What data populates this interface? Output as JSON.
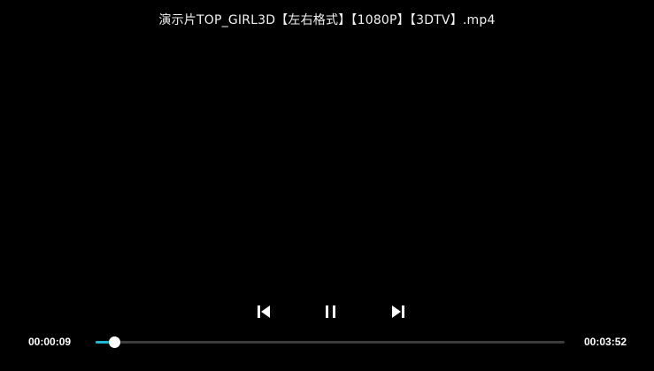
{
  "video": {
    "title": "演示片TOP_GIRL3D【左右格式】【1080P】【3DTV】.mp4"
  },
  "controls": {
    "previous_icon": "skip-previous-icon",
    "pause_icon": "pause-icon",
    "next_icon": "skip-next-icon"
  },
  "playback": {
    "current_time": "00:00:09",
    "total_time": "00:03:52",
    "progress_fraction": 0.039
  },
  "colors": {
    "background": "#000000",
    "accent": "#1fb8d6",
    "track": "#3c3c3c",
    "thumb": "#ffffff"
  }
}
